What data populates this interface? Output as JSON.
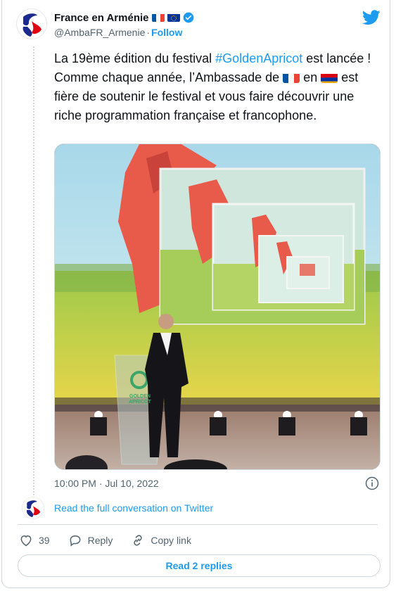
{
  "author": {
    "name": "France en Arménie",
    "handle": "@AmbaFR_Armenie",
    "separator": "·",
    "follow_label": "Follow"
  },
  "tweet": {
    "text_before_hashtag": "La 19ème édition du festival ",
    "hashtag": "#GoldenApricot",
    "text_after_hashtag": " est lancée ! Comme chaque année, l’Ambassade de ",
    "text_line2_start": "en ",
    "text_after_flag2": " est fière de soutenir le festival et vous faire découvrir une riche programmation française et francophone."
  },
  "photo": {
    "podium_logo_line1": "GOLDEN",
    "podium_logo_line2": "APRICOT"
  },
  "timestamp": "10:00 PM · Jul 10, 2022",
  "read_conversation_label": "Read the full conversation on Twitter",
  "actions": {
    "like_count": "39",
    "reply_label": "Reply",
    "copy_link_label": "Copy link"
  },
  "read_replies_label": "Read 2 replies",
  "colors": {
    "accent": "#1d9bf0",
    "secondary_text": "#536471",
    "border": "#cfd9de"
  }
}
